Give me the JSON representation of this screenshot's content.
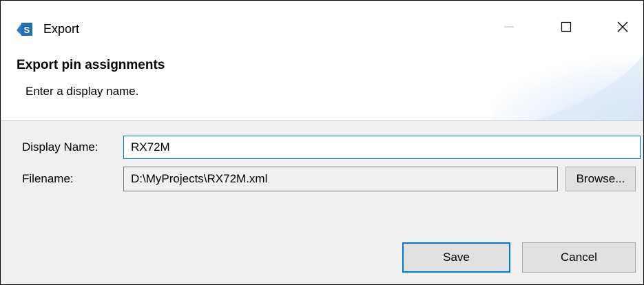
{
  "window": {
    "title": "Export",
    "icon": "app-s-icon",
    "controls": [
      "minimize-icon",
      "maximize-icon",
      "close-icon"
    ]
  },
  "banner": {
    "title": "Export pin assignments",
    "description": "Enter a display name."
  },
  "form": {
    "display_name_label": "Display Name:",
    "display_name_value": "RX72M",
    "filename_label": "Filename:",
    "filename_value": "D:\\MyProjects\\RX72M.xml",
    "browse_label": "Browse..."
  },
  "buttons": {
    "save_label": "Save",
    "cancel_label": "Cancel"
  },
  "colors": {
    "focus_accent": "#0078d7",
    "dialog_background": "#f0f0f0",
    "icon_blue": "#1f6fb5"
  }
}
